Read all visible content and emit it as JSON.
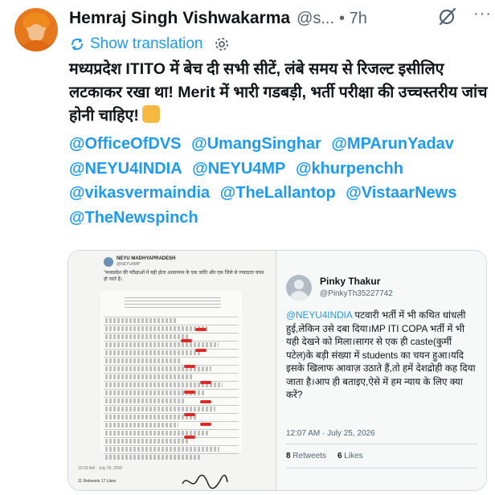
{
  "author": {
    "name": "Hemraj Singh Vishwakarma",
    "handle": "@s...",
    "time": "• 7h"
  },
  "translate": {
    "label": "Show translation"
  },
  "tweet": {
    "text": "मध्यप्रदेश ITITO में बेच दी सभी सीटें, लंबे समय से रिजल्ट इसीलिए लटकाकर रखा था! Merit में भारी गडबड़ी, भर्ती परीक्षा की उच्चस्तरीय जांच होनी चाहिए!",
    "emoji_name": "raised-fist-emoji",
    "mentions": [
      "@OfficeOfDVS",
      "@UmangSinghar",
      "@MPArunYadav",
      "@NEYU4INDIA",
      "@NEYU4MP",
      "@khurpenchh",
      "@vikasvermaindia",
      "@TheLallantop",
      "@VistaarNews",
      "@TheNewspinch"
    ]
  },
  "document_image": {
    "account_name": "NEYU MADHYAPRADESH",
    "account_handle": "@NEYU4MP",
    "caption": "\"मध्यप्रदेश की परीक्षाओं में यही होता आवागमन के एक जाति और एक जिले से ज्यादातर चयन हो जाते है।",
    "footer_time": "10:03 AM · July 25, 2026",
    "footer_stats": "11 Retweets   17 Likes"
  },
  "quoted_tweet": {
    "name": "Pinky Thakur",
    "handle": "@PinkyTh35227742",
    "mention": "@NEYU4INDIA",
    "text": " पटवारी भर्ती में भी कथित धांधली हुई,लेकिन उसे दबा दिया।MP ITI COPA भर्ती में भी यही देखने को मिला।सागर से एक ही caste(कुर्मी पटेल)के बड़ी संख्या में students का चयन हुआ।यदि इसके खिलाफ आवाज़ उठाते हैं,तो हमें देशद्रोही कह दिया जाता है।आप ही बताइए,ऐसे में हम न्याय के लिए क्या करें?",
    "timestamp": "12:07 AM · July 25, 2026",
    "retweets": "8",
    "retweets_label": "Retweets",
    "likes": "6",
    "likes_label": "Likes"
  },
  "colors": {
    "link": "#1d9bf0",
    "secondary": "#536471",
    "text": "#0f1419",
    "border": "#cfd9de"
  }
}
